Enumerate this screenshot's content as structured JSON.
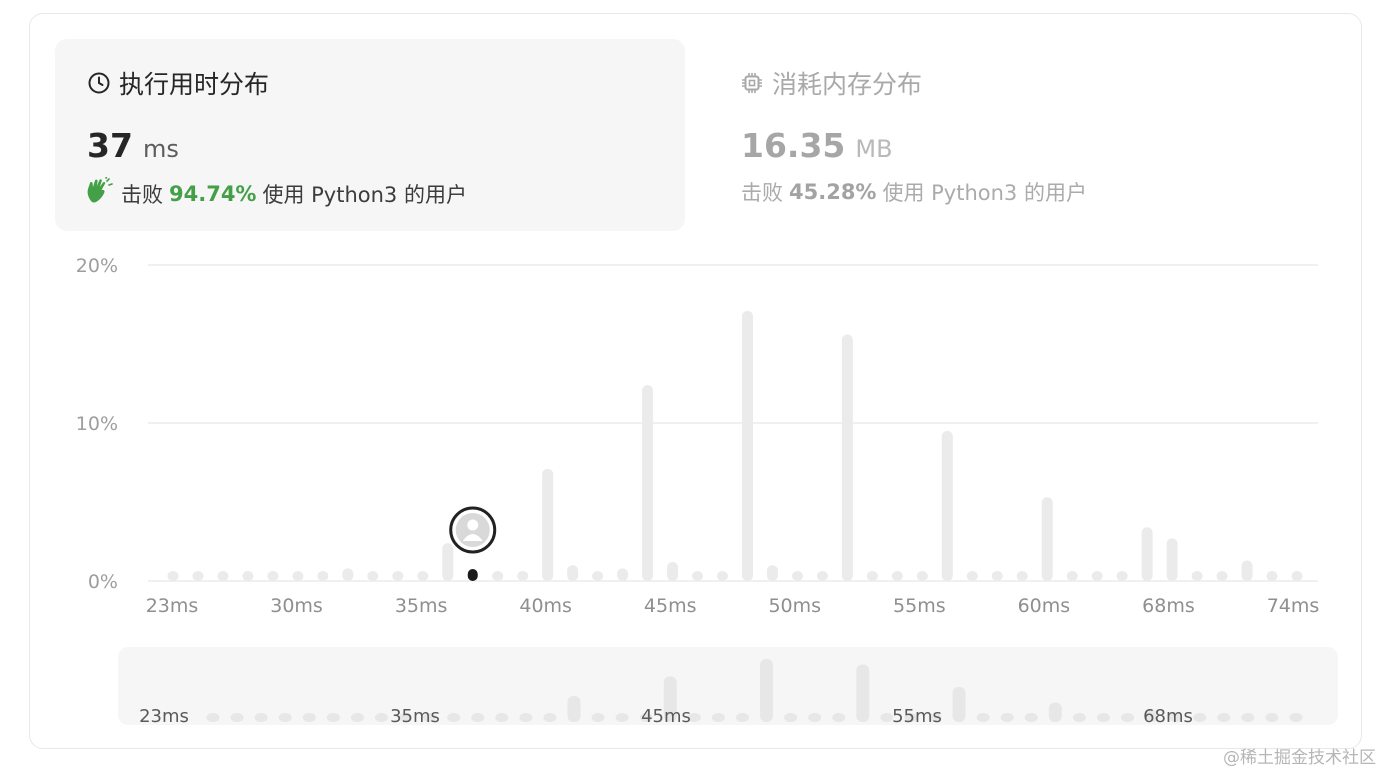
{
  "runtime": {
    "title": "执行用时分布",
    "value": "37",
    "unit": "ms",
    "beats_prefix": "击败",
    "beats_pct": "94.74%",
    "beats_suffix": "使用 Python3 的用户",
    "icon": "clock-icon"
  },
  "memory": {
    "title": "消耗内存分布",
    "value": "16.35",
    "unit": "MB",
    "beats_prefix": "击败",
    "beats_pct": "45.28%",
    "beats_suffix": "使用 Python3 的用户",
    "icon": "chip-icon"
  },
  "colors": {
    "accent_green": "#43a047",
    "bar": "#ebebeb",
    "marker": "#1a1a1a"
  },
  "watermark": "@稀土掘金技术社区",
  "chart_data": {
    "type": "bar",
    "ylim": [
      0,
      20
    ],
    "yticks": [
      "0%",
      "10%",
      "20%"
    ],
    "grid": true,
    "xticks": [
      "23ms",
      "30ms",
      "35ms",
      "40ms",
      "45ms",
      "50ms",
      "55ms",
      "60ms",
      "68ms",
      "74ms"
    ],
    "values": [
      0.5,
      0.5,
      0.5,
      0.5,
      0.5,
      0.5,
      0.5,
      0.8,
      0.5,
      0.5,
      0.5,
      2.4,
      0,
      0.5,
      0.5,
      7.1,
      1.0,
      0.5,
      0.8,
      12.4,
      1.2,
      0.6,
      0.6,
      17.1,
      1.0,
      0.6,
      0.5,
      15.6,
      0.5,
      0.5,
      0.5,
      9.5,
      0.5,
      0.5,
      0.5,
      5.3,
      0.5,
      0.5,
      0.5,
      3.4,
      2.7,
      0.5,
      0.5,
      1.3,
      0.5,
      0.5
    ],
    "highlight_index": 12,
    "highlight_label": "37ms",
    "overview_xticks": [
      "23ms",
      "35ms",
      "45ms",
      "55ms",
      "68ms"
    ]
  }
}
